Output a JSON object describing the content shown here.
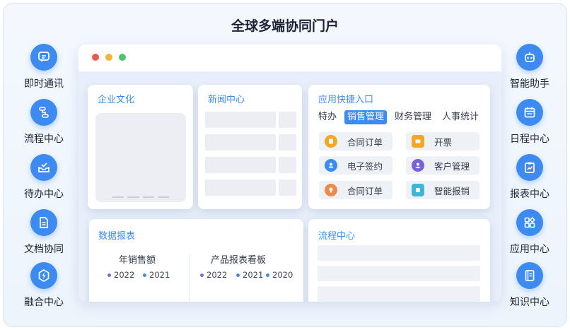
{
  "title": "全球多端协同门户",
  "left_items": [
    {
      "label": "即时通讯",
      "icon": "chat-icon"
    },
    {
      "label": "流程中心",
      "icon": "flow-icon"
    },
    {
      "label": "待办中心",
      "icon": "inbox-icon"
    },
    {
      "label": "文档协同",
      "icon": "document-icon"
    },
    {
      "label": "融合中心",
      "icon": "lightning-icon"
    }
  ],
  "right_items": [
    {
      "label": "智能助手",
      "icon": "robot-icon"
    },
    {
      "label": "日程中心",
      "icon": "calendar-icon"
    },
    {
      "label": "报表中心",
      "icon": "clipboard-chart-icon"
    },
    {
      "label": "应用中心",
      "icon": "apps-grid-icon"
    },
    {
      "label": "知识中心",
      "icon": "book-icon"
    }
  ],
  "window": {
    "culture": {
      "title": "企业文化"
    },
    "news": {
      "title": "新闻中心"
    },
    "quick": {
      "title": "应用快捷入口",
      "tabs": [
        "特办",
        "销售管理",
        "财务管理",
        "人事统计"
      ],
      "active_tab": "销售管理",
      "items": [
        {
          "label": "合同订单",
          "icon": "order-icon",
          "color": "#f5a623"
        },
        {
          "label": "开票",
          "icon": "ticket-icon",
          "color": "#f5a623"
        },
        {
          "label": "电子签约",
          "icon": "user-sign-icon",
          "color": "#3d8bf2"
        },
        {
          "label": "客户管理",
          "icon": "customer-icon",
          "color": "#7b61d9"
        },
        {
          "label": "合同订单",
          "icon": "bulb-icon",
          "color": "#f08a4b"
        },
        {
          "label": "智能报销",
          "icon": "receipt-icon",
          "color": "#3fb6d8"
        }
      ]
    },
    "data_report": {
      "title": "数据报表",
      "left": {
        "label": "年销售额",
        "legend": [
          {
            "name": "2022",
            "color": "#6b6fd4"
          },
          {
            "name": "2021",
            "color": "#3d8bf2"
          }
        ]
      },
      "right": {
        "label": "产品报表看板",
        "legend": [
          {
            "name": "2022",
            "color": "#6b6fd4"
          },
          {
            "name": "2021",
            "color": "#3d8bf2"
          },
          {
            "name": "2020",
            "color": "#3d8bf2"
          }
        ]
      }
    },
    "flow": {
      "title": "流程中心"
    }
  },
  "colors": {
    "accent": "#3d8bf2",
    "dot_red": "#f0584f",
    "dot_yellow": "#f5b43a",
    "dot_green": "#4cc46a"
  }
}
